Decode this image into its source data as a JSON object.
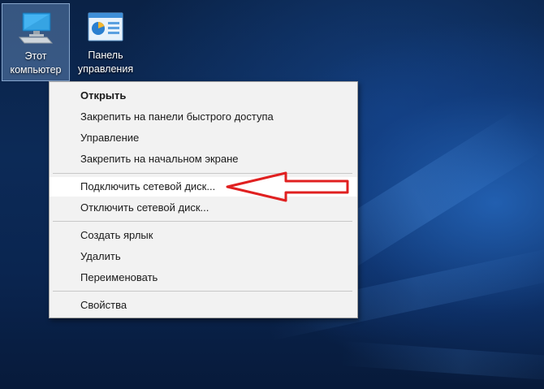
{
  "desktop": {
    "icons": [
      {
        "label_line1": "Этот",
        "label_line2": "компьютер",
        "icon": "computer-icon",
        "selected": true
      },
      {
        "label_line1": "Панель",
        "label_line2": "управления",
        "icon": "control-panel-icon",
        "selected": false
      }
    ]
  },
  "context_menu": {
    "items": [
      {
        "label": "Открыть"
      },
      {
        "label": "Закрепить на панели быстрого доступа"
      },
      {
        "label": "Управление"
      },
      {
        "label": "Закрепить на начальном экране"
      },
      {
        "label": "Подключить сетевой диск..."
      },
      {
        "label": "Отключить сетевой диск..."
      },
      {
        "label": "Создать ярлык"
      },
      {
        "label": "Удалить"
      },
      {
        "label": "Переименовать"
      },
      {
        "label": "Свойства"
      }
    ]
  },
  "colors": {
    "desktop_bg": "#0c2a57",
    "menu_bg": "#f2f2f2",
    "annotation_arrow": "#e02020"
  }
}
